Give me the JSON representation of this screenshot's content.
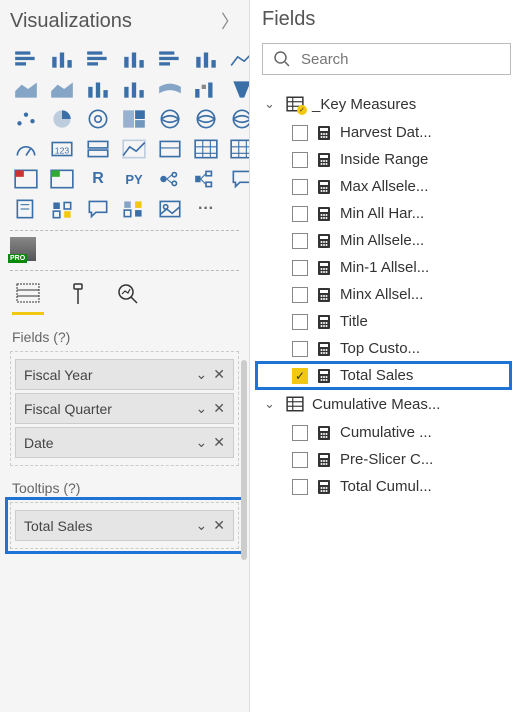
{
  "vizPanel": {
    "title": "Visualizations",
    "icons": [
      "stacked-bar",
      "stacked-column",
      "clustered-bar",
      "clustered-column",
      "100-stacked-bar",
      "100-stacked-column",
      "line",
      "area",
      "stacked-area",
      "line-stacked-column",
      "line-clustered-column",
      "ribbon",
      "waterfall",
      "funnel",
      "scatter",
      "pie",
      "donut",
      "treemap",
      "map",
      "filled-map",
      "shape-map",
      "gauge",
      "card",
      "multi-row-card",
      "kpi",
      "slicer",
      "table",
      "matrix",
      "r-visual-badge",
      "python-visual-badge",
      "r-visual",
      "python-visual",
      "key-influencers",
      "decomposition",
      "q-and-a",
      "paginated",
      "data-point",
      "speech",
      "apps",
      "image",
      "more"
    ],
    "rLabel": "R",
    "pyLabel": "PY",
    "moreLabel": "···",
    "proLabel": "PRO",
    "tabs": [
      "fields",
      "format",
      "analytics"
    ],
    "fieldsLabel": "Fields (?)",
    "tooltipsLabel": "Tooltips (?)",
    "fieldWells": [
      "Fiscal Year",
      "Fiscal Quarter",
      "Date"
    ],
    "tooltipWells": [
      "Total Sales"
    ]
  },
  "fieldsPanel": {
    "title": "Fields",
    "searchPlaceholder": "Search",
    "groups": [
      {
        "name": "_Key Measures",
        "hasBadge": true,
        "expanded": true,
        "items": [
          {
            "label": "Harvest Dat...",
            "checked": false
          },
          {
            "label": "Inside Range",
            "checked": false
          },
          {
            "label": "Max Allsele...",
            "checked": false
          },
          {
            "label": "Min All Har...",
            "checked": false
          },
          {
            "label": "Min Allsele...",
            "checked": false
          },
          {
            "label": "Min-1 Allsel...",
            "checked": false
          },
          {
            "label": "Minx Allsel...",
            "checked": false
          },
          {
            "label": "Title",
            "checked": false
          },
          {
            "label": "Top Custo...",
            "checked": false
          },
          {
            "label": "Total Sales",
            "checked": true,
            "highlight": true
          }
        ]
      },
      {
        "name": "Cumulative Meas...",
        "hasBadge": false,
        "expanded": true,
        "items": [
          {
            "label": "Cumulative ...",
            "checked": false
          },
          {
            "label": "Pre-Slicer C...",
            "checked": false
          },
          {
            "label": "Total Cumul...",
            "checked": false
          }
        ]
      }
    ]
  }
}
